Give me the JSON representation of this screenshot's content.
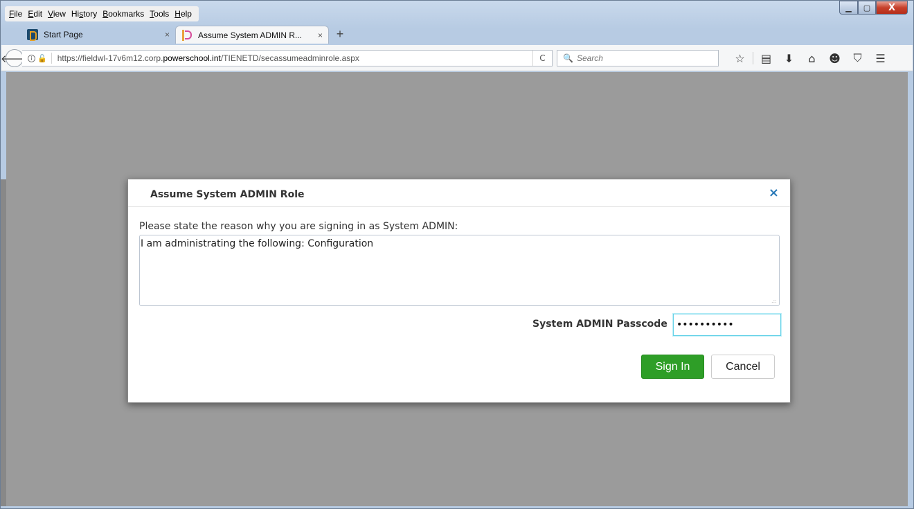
{
  "window": {
    "controls": {
      "minimize": "▁",
      "maximize": "▢",
      "close": "X"
    }
  },
  "menubar": {
    "items": [
      {
        "label": "File",
        "access_key": "F",
        "rest": "ile"
      },
      {
        "label": "Edit",
        "access_key": "E",
        "rest": "dit"
      },
      {
        "label": "View",
        "access_key": "V",
        "rest": "iew"
      },
      {
        "label": "History",
        "pre": "Hi",
        "access_key": "s",
        "rest": "tory"
      },
      {
        "label": "Bookmarks",
        "access_key": "B",
        "rest": "ookmarks"
      },
      {
        "label": "Tools",
        "access_key": "T",
        "rest": "ools"
      },
      {
        "label": "Help",
        "access_key": "H",
        "rest": "elp"
      }
    ]
  },
  "tabs": [
    {
      "title": "Start Page",
      "close": "×",
      "active": false,
      "icon": "powerschool-icon"
    },
    {
      "title": "Assume System ADMIN R...",
      "close": "×",
      "active": true,
      "icon": "powerschool-p-icon"
    }
  ],
  "new_tab": "+",
  "navbar": {
    "back": "🡐",
    "url_prefix": "https://fieldwl-17v6m12.corp.",
    "url_domain": "powerschool.int",
    "url_suffix": "/TIENETD/secassumeadminrole.aspx",
    "reload": "C",
    "search_placeholder": "Search",
    "toolbar_icons": [
      "star-icon",
      "reading-list-icon",
      "download-icon",
      "home-icon",
      "smiley-icon",
      "pocket-icon",
      "hamburger-menu-icon"
    ]
  },
  "dialog": {
    "title": "Assume System ADMIN Role",
    "close": "×",
    "reason_label": "Please state the reason why you are signing in as System ADMIN:",
    "reason_value": "I am administrating the following: Configuration",
    "passcode_label": "System ADMIN Passcode",
    "passcode_value": "••••••••••",
    "sign_in": "Sign In",
    "cancel": "Cancel"
  },
  "colors": {
    "content_bg": "#9b9b9b",
    "accent_blue": "#2a7ab8",
    "sign_in_green": "#2e9e27",
    "focus_cyan": "#65d2e8"
  }
}
